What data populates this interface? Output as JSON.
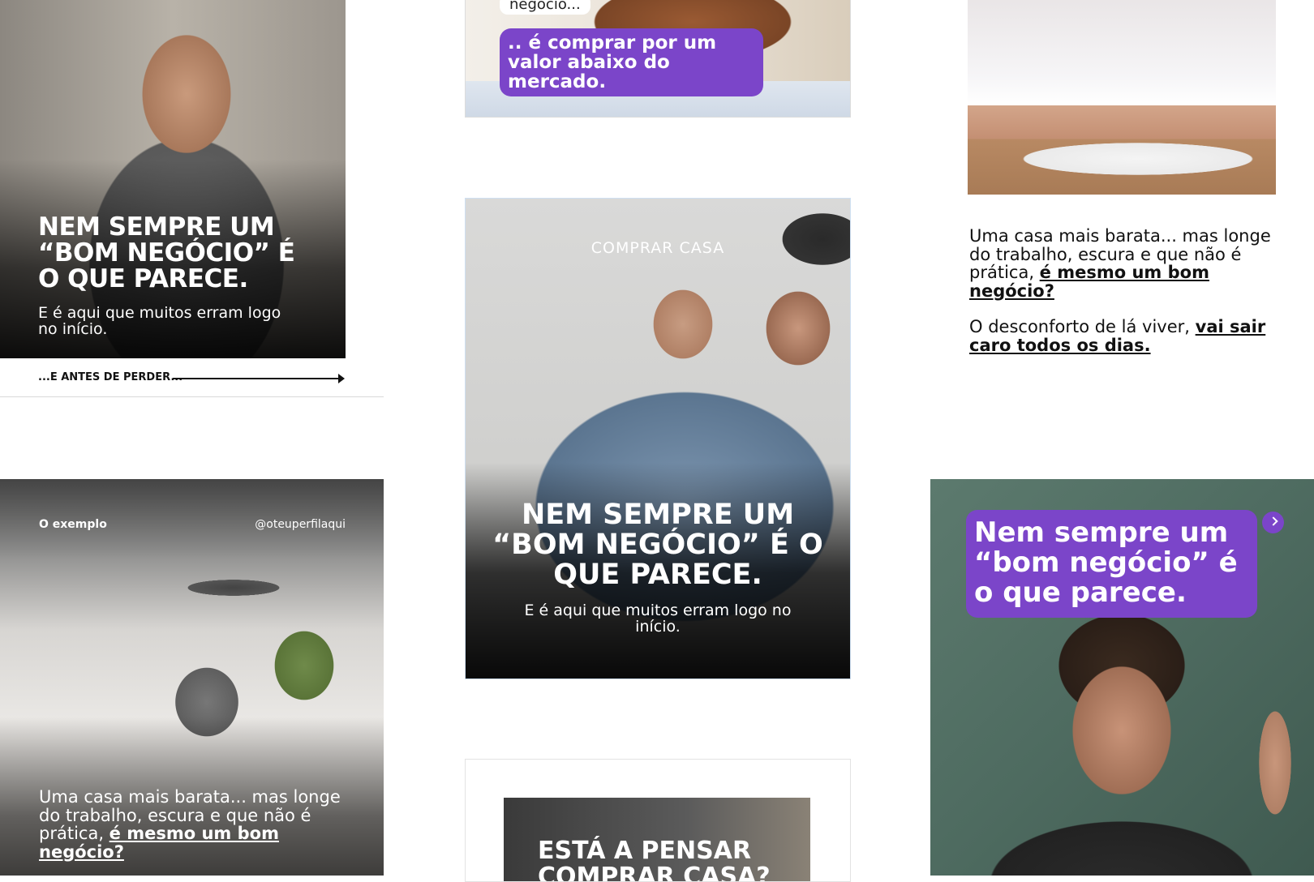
{
  "card1": {
    "title": "Nem sempre um “bom negócio” é o que parece.",
    "subtitle": "E é aqui que muitos erram logo no início.",
    "footer_label": "...E ANTES DE PERDER..."
  },
  "card2": {
    "pill_top": "negócio...",
    "pill_main": ".. é comprar por um valor abaixo do mercado."
  },
  "card3": {
    "para1_plain": "Uma casa mais barata... mas longe do trabalho, escura e que não é prática, ",
    "para1_bold": "é mesmo um bom negócio?",
    "para2_plain": "O desconforto de lá viver, ",
    "para2_bold": "vai sair caro todos os dias."
  },
  "card4": {
    "kicker": "COMPRAR CASA",
    "title": "Nem sempre um “bom negócio” é o que parece.",
    "subtitle": "E é aqui que muitos erram logo no início."
  },
  "card5": {
    "label": "O exemplo",
    "handle": "@oteuperfilaqui",
    "text_plain": "Uma casa mais barata... mas longe do trabalho, escura e que não é prática, ",
    "text_bold": "é mesmo um bom negócio?"
  },
  "card6": {
    "title": "ESTÁ A PENSAR COMPRAR CASA?"
  },
  "card7": {
    "bubble": "Nem sempre um “bom negócio” é o que parece.",
    "next_icon": "chevron-right-icon"
  },
  "colors": {
    "accent": "#7b45c9"
  }
}
